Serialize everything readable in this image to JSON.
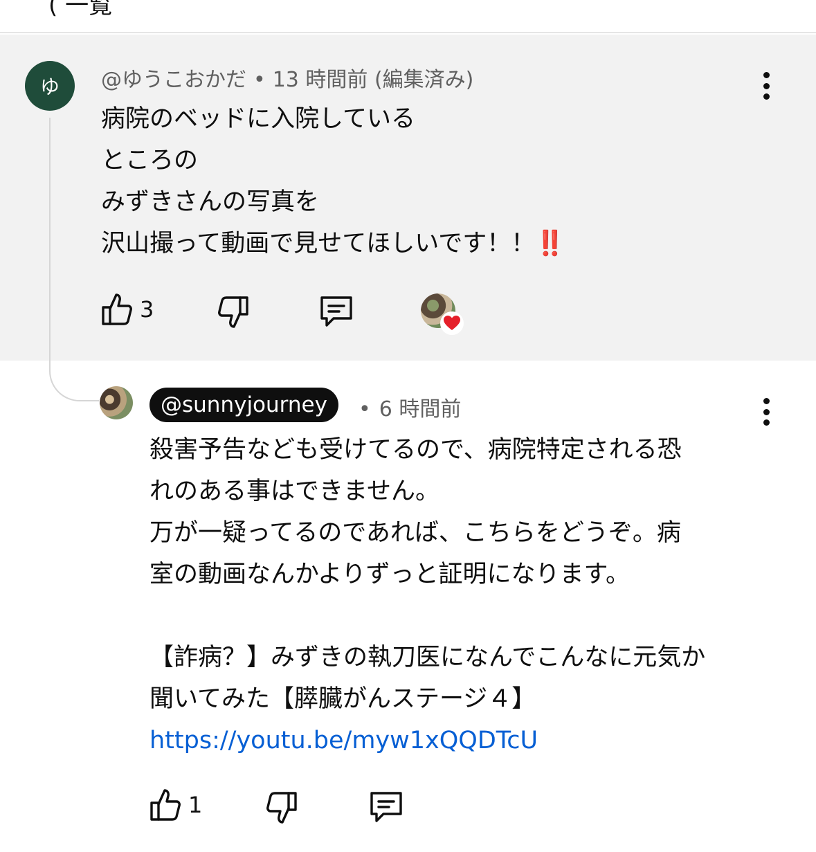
{
  "header": {
    "partial_text": "(  一覧"
  },
  "parent_comment": {
    "avatar_letter": "ゆ",
    "handle": "@ゆうこおかだ",
    "separator": "•",
    "time": "13 時間前",
    "edited": "(編集済み)",
    "lines": [
      "病院のベッドに入院している",
      "ところの",
      "みずきさんの写真を",
      "沢山撮って動画で見せてほしいです！！"
    ],
    "emphasis": "‼️",
    "like_count": "3"
  },
  "reply": {
    "handle": "@sunnyjourney",
    "separator": "•",
    "time": "6 時間前",
    "lines": [
      "殺害予告なども受けてるので、病院特定される恐",
      "れのある事はできません。",
      "万が一疑ってるのであれば、こちらをどうぞ。病",
      "室の動画なんかよりずっと証明になります。",
      "",
      "【詐病？】みずきの執刀医になんでこんなに元気か",
      "聞いてみた【膵臓がんステージ４】"
    ],
    "link": "https://youtu.be/myw1xQQDTcU",
    "like_count": "1"
  },
  "icons": [
    "like-icon",
    "dislike-icon",
    "reply-icon",
    "more-icon",
    "heart-icon"
  ],
  "colors": {
    "parent_bg": "#f2f2f2",
    "avatar_bg": "#1f4c3a",
    "link": "#065fd4",
    "heart": "#e5202a"
  }
}
